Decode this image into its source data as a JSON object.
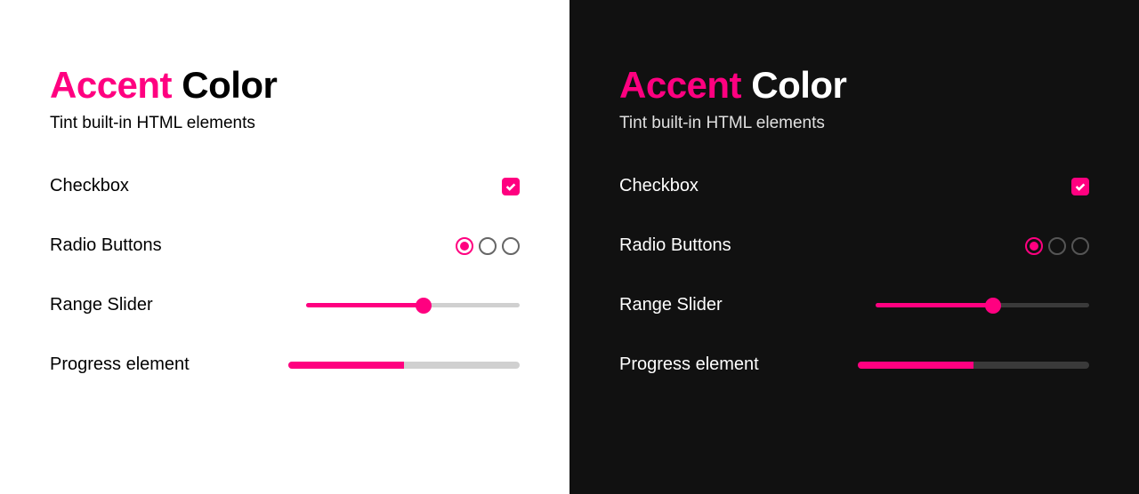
{
  "accent_color": "#ff0080",
  "title": {
    "accent_word": "Accent",
    "rest": "Color"
  },
  "subtitle": "Tint built-in HTML elements",
  "rows": {
    "checkbox": {
      "label": "Checkbox",
      "checked": true
    },
    "radio": {
      "label": "Radio Buttons",
      "options": 3,
      "selected_index": 0
    },
    "range": {
      "label": "Range Slider",
      "value": 55,
      "min": 0,
      "max": 100
    },
    "progress": {
      "label": "Progress element",
      "value": 50,
      "max": 100
    }
  }
}
